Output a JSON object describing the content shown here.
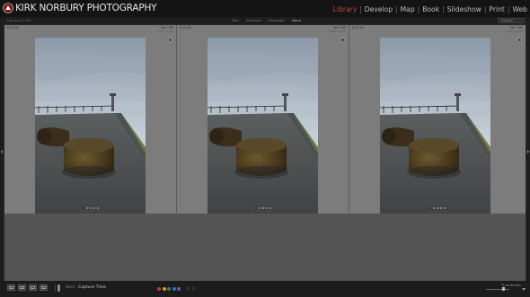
{
  "app": {
    "brand": "KIRK NORBURY PHOTOGRAPHY",
    "modules": [
      "Library",
      "Develop",
      "Map",
      "Book",
      "Slideshow",
      "Print",
      "Web"
    ],
    "active_module": "Library",
    "accent_color": "#c8463f"
  },
  "panel_bar": {
    "path": "Lib Acq 17 sfn",
    "filters": [
      "Text",
      "Attribute",
      "Metadata",
      "None"
    ],
    "active_filter": "None",
    "preset": "Custom"
  },
  "grid": {
    "cells": [
      {
        "filename": "6.21 fit",
        "filesize": "36.1 MP",
        "dims": "3456 x 5184",
        "photo": "bollard-pier",
        "flag": "badge-icon"
      },
      {
        "filename": "6.21 fit",
        "filesize": "36.1 MP",
        "dims": "3456 x 5184",
        "photo": "bollard-pier",
        "flag": "badge-icon"
      },
      {
        "filename": "6.21 fit",
        "filesize": "36.1 MP",
        "dims": "3456 x 5184",
        "photo": "bollard-pier",
        "flag": "badge-icon"
      }
    ],
    "dots_count": 5,
    "active_dot": 0
  },
  "toolbar": {
    "view_buttons": [
      "grid-view-icon",
      "loupe-view-icon",
      "compare-view-icon",
      "survey-view-icon"
    ],
    "sort_label": "Sort:",
    "sort_value": "Capture Time",
    "color_labels": [
      "#c0392b",
      "#d4a017",
      "#2e8b3a",
      "#2f6fd6",
      "#8c46b4"
    ],
    "thumbnails_label": "Thumbnails",
    "thumb_level": 0.8
  }
}
